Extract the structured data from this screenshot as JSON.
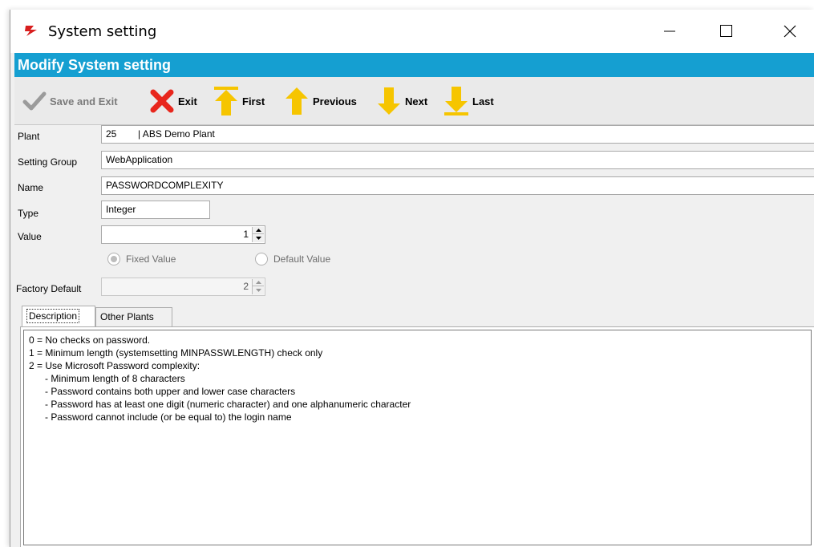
{
  "window": {
    "title": "System setting",
    "icon": "red-pin-icon"
  },
  "header": {
    "title": "Modify System setting"
  },
  "toolbar": {
    "save_exit": "Save and Exit",
    "exit": "Exit",
    "first": "First",
    "previous": "Previous",
    "next": "Next",
    "last": "Last"
  },
  "form": {
    "plant_label": "Plant",
    "plant_value": "25        | ABS Demo Plant",
    "group_label": "Setting Group",
    "group_value": "WebApplication",
    "name_label": "Name",
    "name_value": "PASSWORDCOMPLEXITY",
    "type_label": "Type",
    "type_value": "Integer",
    "value_label": "Value",
    "value_value": "1",
    "fixed_value": "Fixed Value",
    "default_value": "Default Value",
    "factory_label": "Factory Default",
    "factory_value": "2"
  },
  "tabs": {
    "description": "Description",
    "other_plants": "Other Plants"
  },
  "description": {
    "lines": [
      "0 = No checks on password.",
      "1 = Minimum length (systemsetting MINPASSWLENGTH) check only",
      "2 = Use Microsoft Password complexity:",
      "      - Minimum length of 8 characters",
      "      - Password contains both upper and lower case characters",
      "      - Password has at least one digit (numeric character) and one alphanumeric character",
      "      - Password cannot include (or be equal to) the login name"
    ]
  },
  "colors": {
    "header_blue": "#159fd1",
    "arrow_yellow": "#f6c500",
    "exit_red": "#e8261c"
  }
}
